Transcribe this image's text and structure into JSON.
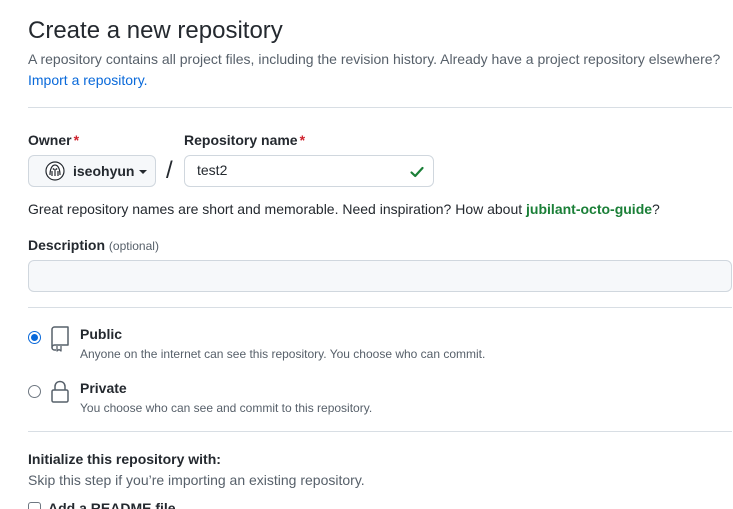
{
  "header": {
    "title": "Create a new repository",
    "subtitle": "A repository contains all project files, including the revision history. Already have a project repository elsewhere?",
    "import_link": "Import a repository."
  },
  "owner": {
    "label": "Owner",
    "required_mark": "*",
    "value": "iseohyun",
    "avatar_icon": "owner-avatar-icon"
  },
  "separator": "/",
  "repository_name": {
    "label": "Repository name",
    "required_mark": "*",
    "value": "test2",
    "valid_icon": "check-icon",
    "valid_color": "#1a7f37"
  },
  "name_hint": {
    "text": "Great repository names are short and memorable. Need inspiration? How about ",
    "suggestion": "jubilant-octo-guide",
    "suffix": "?"
  },
  "description": {
    "label": "Description",
    "optional_text": "(optional)",
    "value": ""
  },
  "visibility": {
    "options": [
      {
        "title": "Public",
        "description": "Anyone on the internet can see this repository. You choose who can commit.",
        "icon": "repo-icon",
        "selected": true
      },
      {
        "title": "Private",
        "description": "You choose who can see and commit to this repository.",
        "icon": "lock-icon",
        "selected": false
      }
    ]
  },
  "initialize": {
    "title": "Initialize this repository with:",
    "subtitle": "Skip this step if you’re importing an existing repository.",
    "readme_label": "Add a README file",
    "readme_checked": false
  },
  "colors": {
    "accent": "#0969da",
    "link": "#0969da",
    "success": "#1a7f37",
    "required": "#cf222e"
  }
}
